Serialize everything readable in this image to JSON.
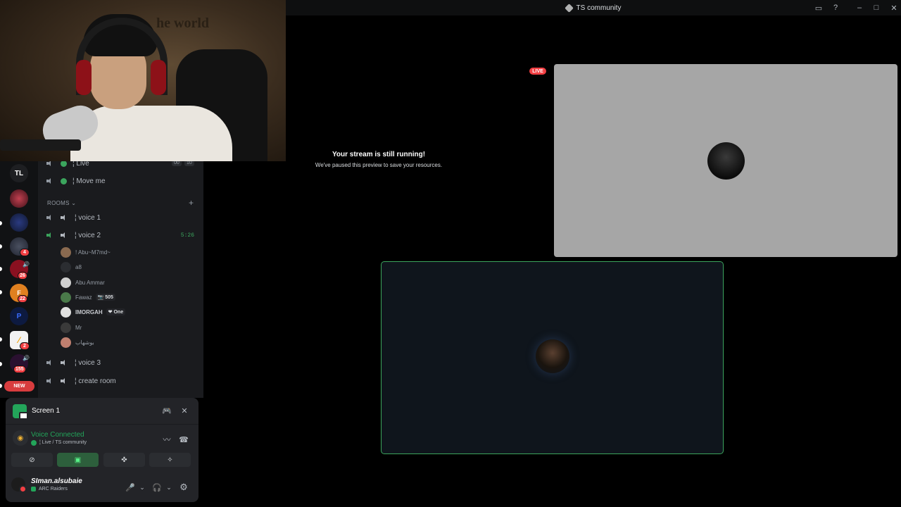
{
  "window": {
    "title": "TS community",
    "buttons": [
      "inbox-icon",
      "help-icon",
      "minimize-icon",
      "maximize-icon",
      "close-icon"
    ]
  },
  "webcam": {
    "wall_text": "he world"
  },
  "servers": [
    {
      "label": "TL",
      "badge": ""
    },
    {
      "label": "",
      "badge": ""
    },
    {
      "label": "",
      "badge": ""
    },
    {
      "label": "",
      "badge": "4"
    },
    {
      "label": "",
      "badge": "26"
    },
    {
      "label": "",
      "badge": "22"
    },
    {
      "label": "P",
      "badge": ""
    },
    {
      "label": "",
      "badge": "2"
    },
    {
      "label": "",
      "badge": "155"
    }
  ],
  "new_pill": "NEW",
  "channels": {
    "live": {
      "name": "¦ Live",
      "count_a": "00",
      "count_b": "10"
    },
    "moveme": {
      "name": "¦ Move me"
    },
    "section": "ROOMS ⌄",
    "plus": "+",
    "voice1": "¦ voice 1",
    "voice2": "¦ voice 2",
    "voice2_time": "5:26",
    "voice3": "¦ voice 3",
    "create": "¦ create room",
    "users": [
      {
        "name": "! Abu~M7md~",
        "tag": ""
      },
      {
        "name": "a8",
        "tag": ""
      },
      {
        "name": "Abu Ammar",
        "tag": ""
      },
      {
        "name": "Fawaz",
        "tag": "📷 505"
      },
      {
        "name": "IMORGAH",
        "tag": "❤ One"
      },
      {
        "name": "Mr",
        "tag": ""
      },
      {
        "name": "بوشهاب",
        "tag": ""
      }
    ]
  },
  "panel": {
    "screen_label": "Screen 1",
    "voice_status": "Voice Connected",
    "voice_channel": "¦ Live / TS community",
    "username": "SIman.alsubaie",
    "activity": "ARC Raiders",
    "icons": {
      "screen_game": "🎮",
      "screen_close": "✕",
      "signal": "〰",
      "hangup": "☎",
      "camera_off": "⊘",
      "share": "▣",
      "activities": "✜",
      "soundboard": "✧",
      "mic": "🎤",
      "headset": "🎧",
      "settings": "⚙",
      "dropdown": "⌄",
      "rss": "◉"
    }
  },
  "stage": {
    "paused_title": "Your stream is still running!",
    "paused_body": "We've paused this preview to save your resources.",
    "live_badge": "LIVE"
  }
}
